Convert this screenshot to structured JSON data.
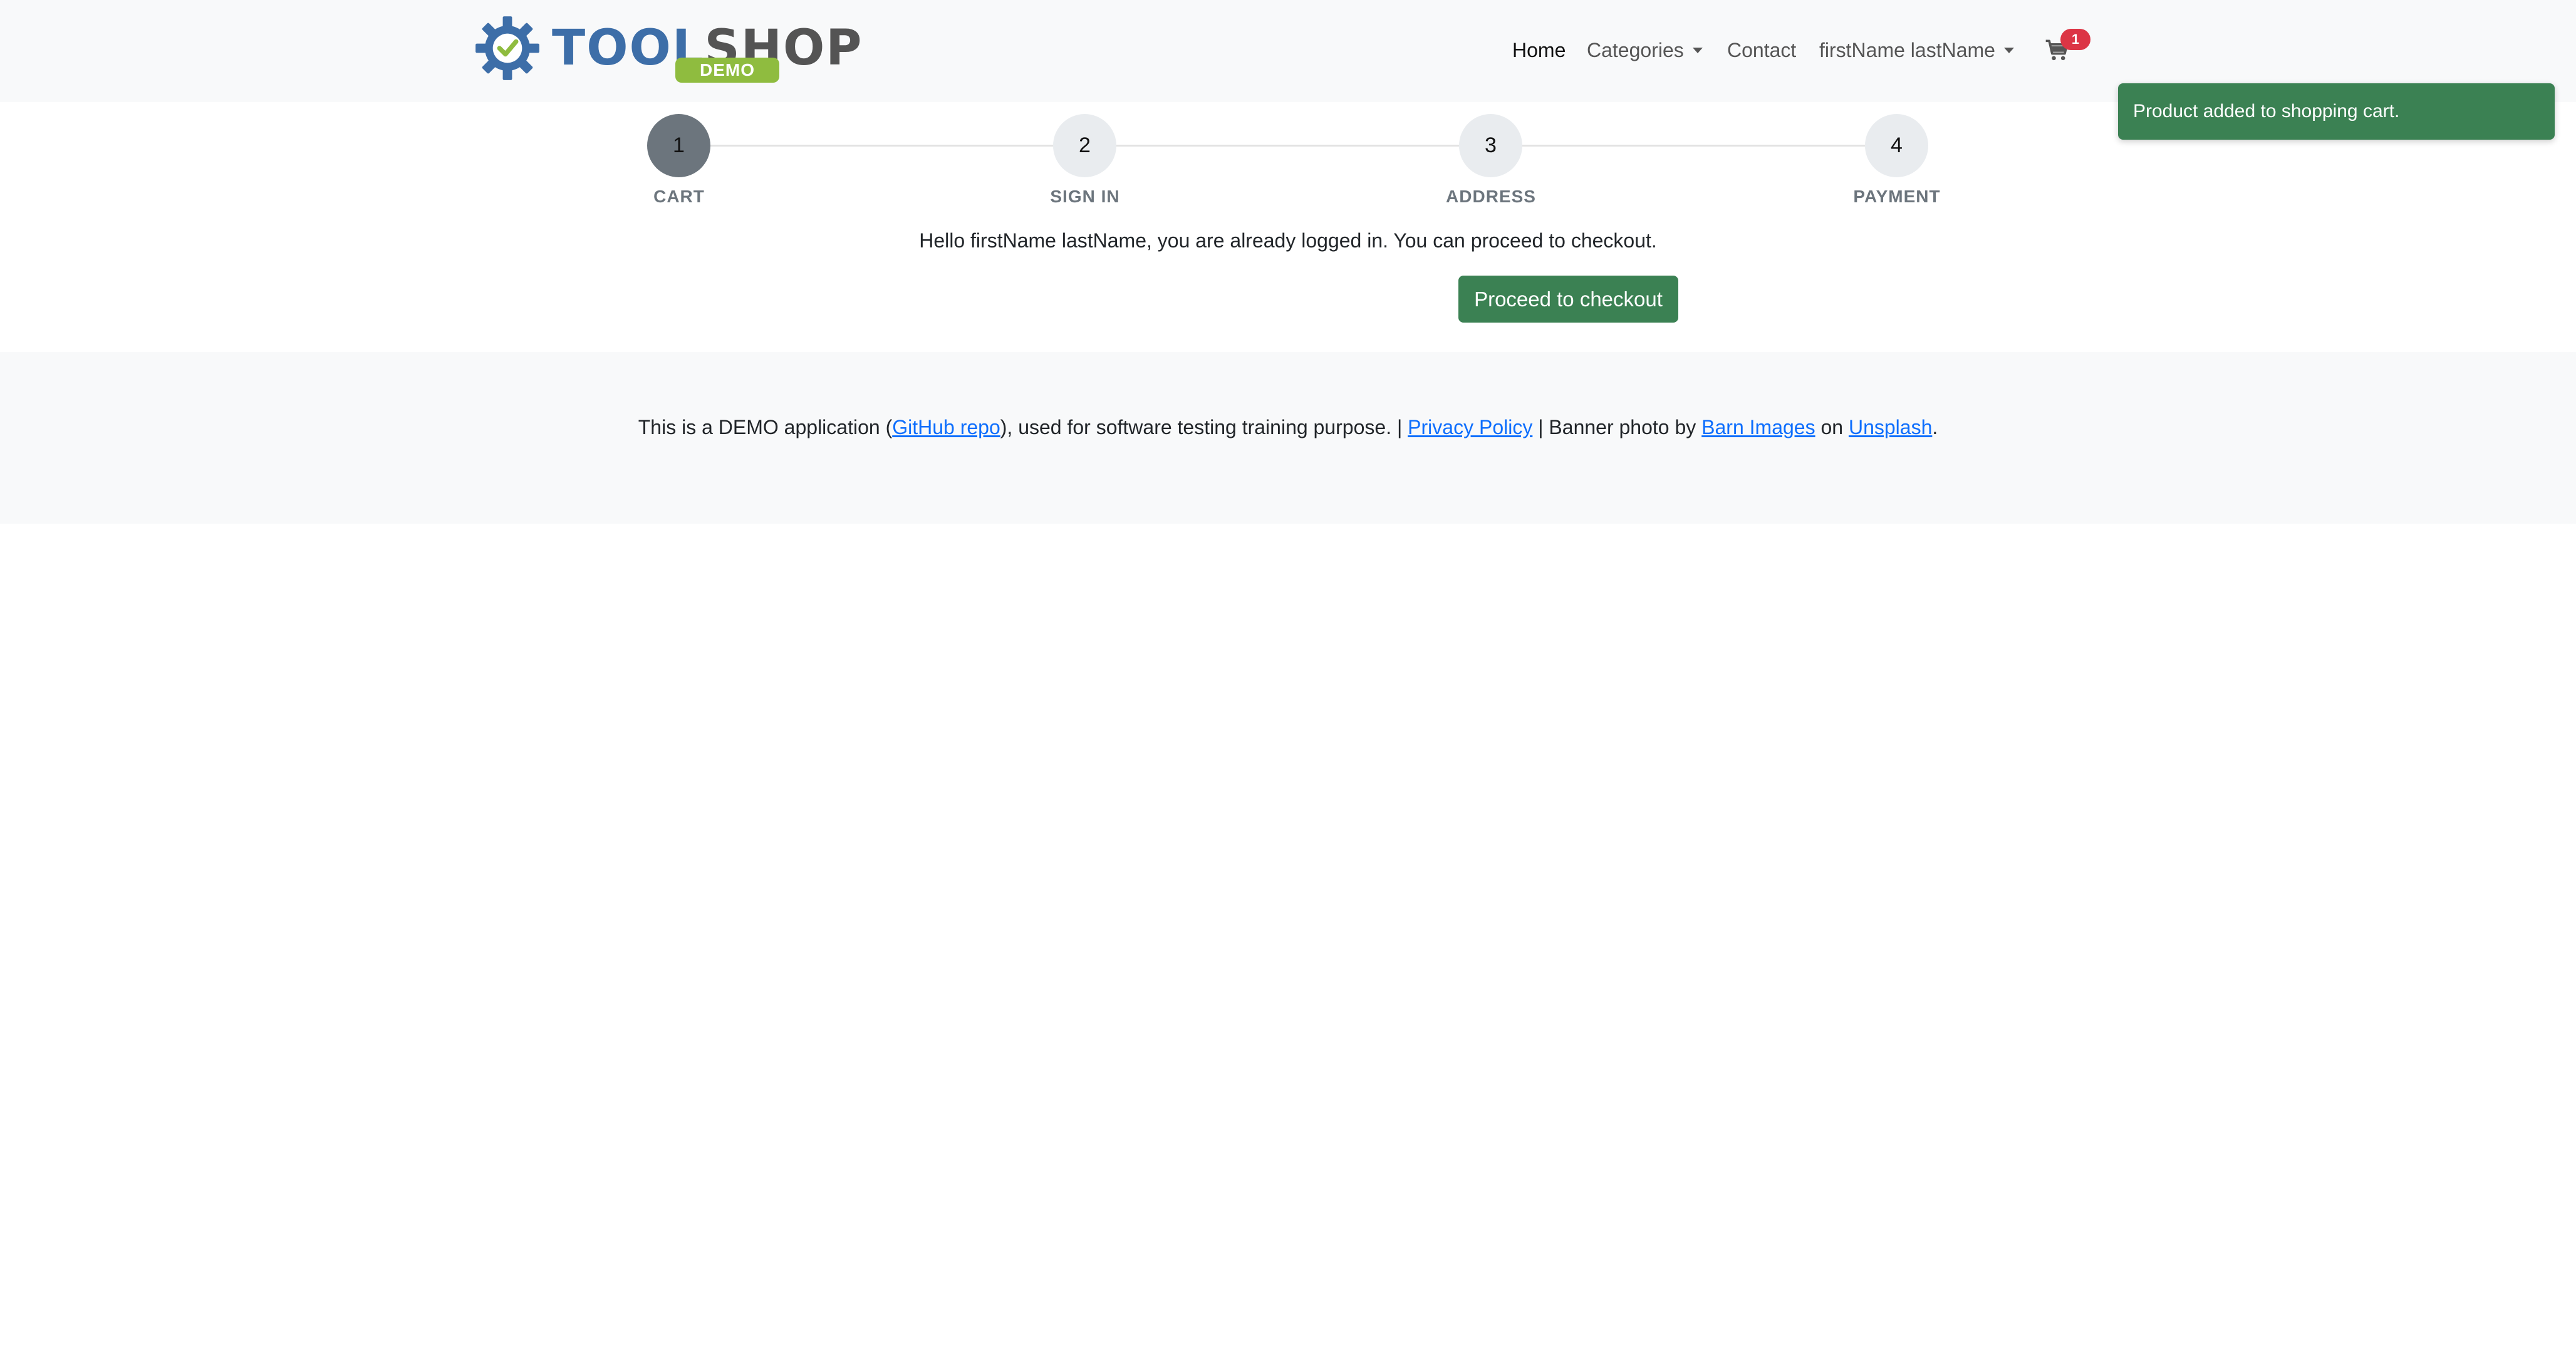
{
  "header": {
    "logo": {
      "tool": "TOOL",
      "shop": "SHOP",
      "badge": "DEMO"
    },
    "nav": {
      "home": "Home",
      "categories": "Categories",
      "contact": "Contact",
      "user": "firstName lastName"
    },
    "cart": {
      "icon": "cart-icon",
      "count": "1"
    }
  },
  "toast": {
    "message": "Product added to shopping cart."
  },
  "steps": [
    {
      "number": "1",
      "label": "CART"
    },
    {
      "number": "2",
      "label": "SIGN IN"
    },
    {
      "number": "3",
      "label": "ADDRESS"
    },
    {
      "number": "4",
      "label": "PAYMENT"
    }
  ],
  "main": {
    "message": "Hello firstName lastName, you are already logged in. You can proceed to checkout.",
    "checkout_button": "Proceed to checkout"
  },
  "footer": {
    "text_1": "This is a DEMO application (",
    "github_link": "GitHub repo",
    "text_2": "), used for software testing training purpose. | ",
    "privacy_link": "Privacy Policy",
    "text_3": " | Banner photo by ",
    "barn_link": "Barn Images",
    "text_4": " on ",
    "unsplash_link": "Unsplash",
    "text_5": "."
  },
  "colors": {
    "brand_blue": "#3d6ea8",
    "brand_gray": "#545454",
    "demo_green": "#8fbc3f",
    "success_green": "#3b8153",
    "badge_red": "#dc3545",
    "link_blue": "#0d6efd"
  }
}
